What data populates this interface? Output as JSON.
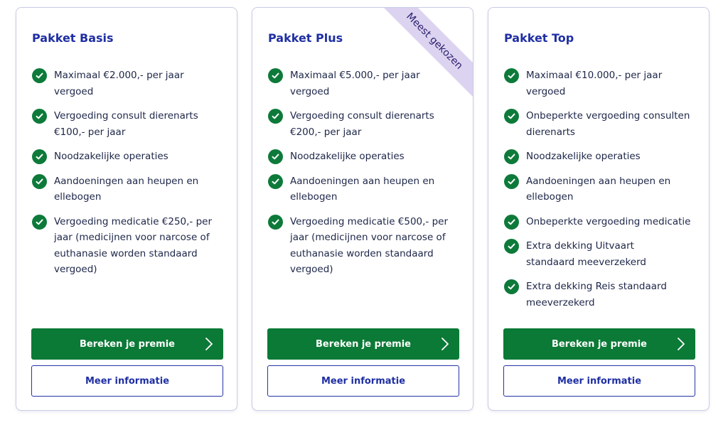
{
  "colors": {
    "accent_green": "#0b7a36",
    "title_blue": "#1f2fa3",
    "ribbon_purple": "#dcd3f0"
  },
  "icons": {
    "feature": "check-circle-icon",
    "button": "chevron-right-icon"
  },
  "plans": [
    {
      "title": "Pakket Basis",
      "features": [
        "Maximaal €2.000,- per jaar vergoed",
        "Vergoeding consult dierenarts €100,- per jaar",
        "Noodzakelijke operaties",
        "Aandoeningen aan heupen en ellebogen",
        "Vergoeding medicatie €250,- per jaar (medicijnen voor narcose of euthanasie worden standaard vergoed)"
      ],
      "primary_cta": "Bereken je premie",
      "secondary_cta": "Meer informatie"
    },
    {
      "title": "Pakket Plus",
      "ribbon": "Meest gekozen",
      "features": [
        "Maximaal €5.000,- per jaar vergoed",
        "Vergoeding consult dierenarts €200,- per jaar",
        "Noodzakelijke operaties",
        "Aandoeningen aan heupen en ellebogen",
        "Vergoeding medicatie €500,- per jaar (medicijnen voor narcose of euthanasie worden standaard vergoed)"
      ],
      "primary_cta": "Bereken je premie",
      "secondary_cta": "Meer informatie"
    },
    {
      "title": "Pakket Top",
      "features": [
        "Maximaal €10.000,- per jaar vergoed",
        "Onbeperkte vergoeding consulten dierenarts",
        "Noodzakelijke operaties",
        "Aandoeningen aan heupen en ellebogen",
        "Onbeperkte vergoeding medicatie",
        "Extra dekking Uitvaart standaard meeverzekerd",
        "Extra dekking Reis standaard meeverzekerd"
      ],
      "primary_cta": "Bereken je premie",
      "secondary_cta": "Meer informatie"
    }
  ]
}
